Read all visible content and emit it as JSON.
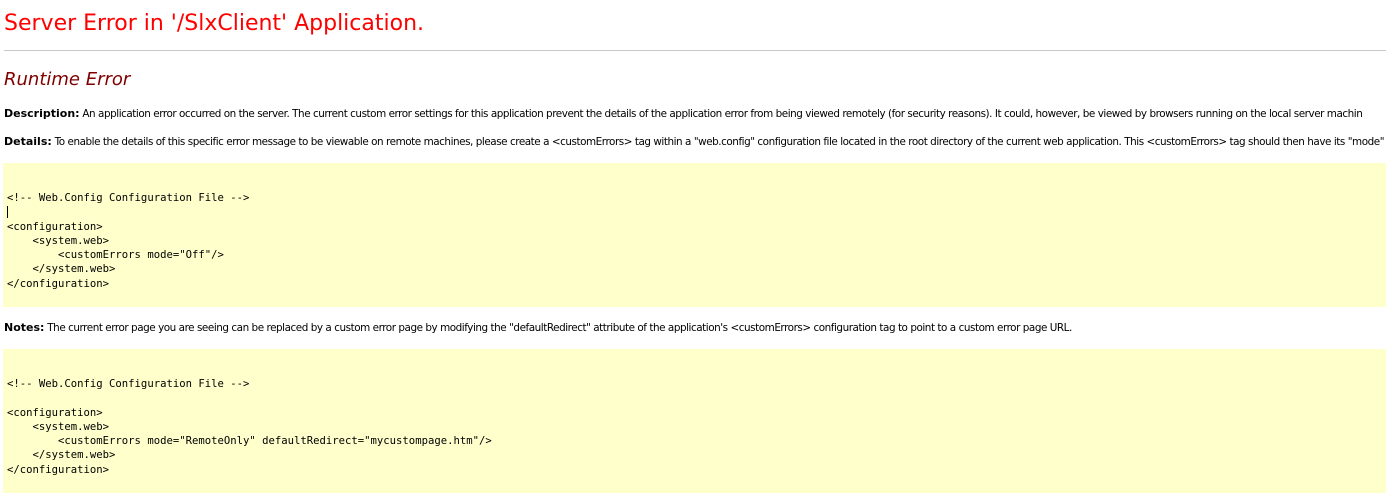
{
  "header": {
    "title": "Server Error in '/SlxClient' Application.",
    "subtitle": "Runtime Error"
  },
  "description": {
    "label": "Description:",
    "text": " An application error occurred on the server. The current custom error settings for this application prevent the details of the application error from being viewed remotely (for security reasons). It could, however, be viewed by browsers running on the local server machin"
  },
  "details": {
    "label": "Details:",
    "text": " To enable the details of this specific error message to be viewable on remote machines, please create a <customErrors> tag within a \"web.config\" configuration file located in the root directory of the current web application. This <customErrors> tag should then have its \"mode\""
  },
  "code_block_1": {
    "lines": [
      "<!-- Web.Config Configuration File -->",
      "",
      "<configuration>",
      "    <system.web>",
      "        <customErrors mode=\"Off\"/>",
      "    </system.web>",
      "</configuration>"
    ]
  },
  "notes": {
    "label": "Notes:",
    "text": " The current error page you are seeing can be replaced by a custom error page by modifying the \"defaultRedirect\" attribute of the application's <customErrors> configuration tag to point to a custom error page URL."
  },
  "code_block_2": {
    "lines": [
      "<!-- Web.Config Configuration File -->",
      "",
      "<configuration>",
      "    <system.web>",
      "        <customErrors mode=\"RemoteOnly\" defaultRedirect=\"mycustompage.htm\"/>",
      "    </system.web>",
      "</configuration>"
    ]
  },
  "colors": {
    "title": "#ff0000",
    "subtitle": "#800000",
    "code_background": "#ffffcc",
    "rule": "#c8c8c8"
  }
}
